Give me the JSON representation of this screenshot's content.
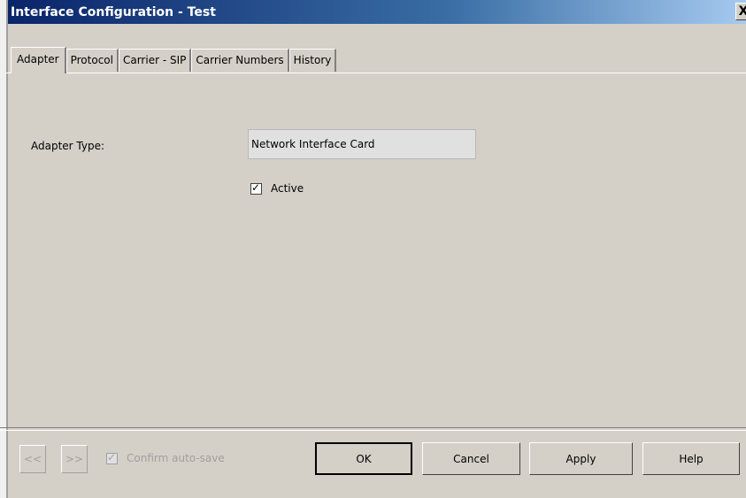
{
  "window": {
    "title": "Interface Configuration - Test",
    "close_symbol": "X"
  },
  "tabs": [
    {
      "label": "Adapter",
      "active": true
    },
    {
      "label": "Protocol",
      "active": false
    },
    {
      "label": "Carrier - SIP",
      "active": false
    },
    {
      "label": "Carrier Numbers",
      "active": false
    },
    {
      "label": "History",
      "active": false
    }
  ],
  "adapter": {
    "type_label": "Adapter Type:",
    "type_value": "Network Interface Card",
    "active_label": "Active",
    "active_checked": true
  },
  "footer": {
    "prev_label": "<<",
    "next_label": ">>",
    "confirm_autosave_label": "Confirm auto-save",
    "confirm_autosave_checked": true,
    "ok_label": "OK",
    "cancel_label": "Cancel",
    "apply_label": "Apply",
    "help_label": "Help"
  }
}
